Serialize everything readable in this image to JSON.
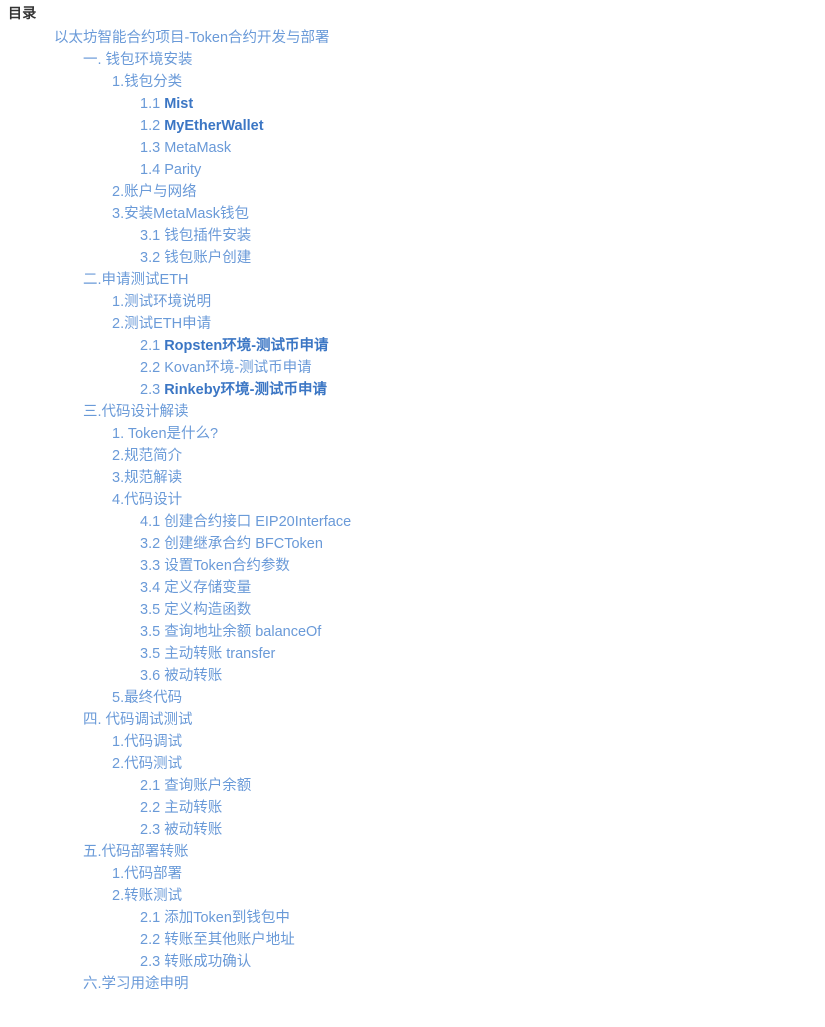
{
  "heading": "目录",
  "colors": {
    "link": "#6a9ad8",
    "link_bold": "#3b76c4",
    "heading": "#333333",
    "background": "#ffffff"
  },
  "toc": {
    "items": [
      {
        "level": 1,
        "num": "",
        "label": "以太坊智能合约项目-Token合约开发与部署",
        "bold": false
      },
      {
        "level": 2,
        "num": "",
        "label": "一. 钱包环境安装",
        "bold": false
      },
      {
        "level": 3,
        "num": "",
        "label": "1.钱包分类",
        "bold": false
      },
      {
        "level": 4,
        "num": "1.1",
        "label": "Mist",
        "bold": true
      },
      {
        "level": 4,
        "num": "1.2",
        "label": "MyEtherWallet",
        "bold": true
      },
      {
        "level": 4,
        "num": "1.3",
        "label": "MetaMask",
        "bold": false
      },
      {
        "level": 4,
        "num": "1.4",
        "label": "Parity",
        "bold": false
      },
      {
        "level": 3,
        "num": "",
        "label": "2.账户与网络",
        "bold": false
      },
      {
        "level": 3,
        "num": "",
        "label": "3.安装MetaMask钱包",
        "bold": false
      },
      {
        "level": 4,
        "num": "3.1",
        "label": "钱包插件安装",
        "bold": false
      },
      {
        "level": 4,
        "num": "3.2",
        "label": "钱包账户创建",
        "bold": false
      },
      {
        "level": 2,
        "num": "",
        "label": "二.申请测试ETH",
        "bold": false
      },
      {
        "level": 3,
        "num": "",
        "label": "1.测试环境说明",
        "bold": false
      },
      {
        "level": 3,
        "num": "",
        "label": "2.测试ETH申请",
        "bold": false
      },
      {
        "level": 4,
        "num": "2.1",
        "label": "Ropsten环境-测试币申请",
        "bold": true
      },
      {
        "level": 4,
        "num": "2.2",
        "label": "Kovan环境-测试币申请",
        "bold": false
      },
      {
        "level": 4,
        "num": "2.3",
        "label": "Rinkeby环境-测试币申请",
        "bold": true
      },
      {
        "level": 2,
        "num": "",
        "label": "三.代码设计解读",
        "bold": false
      },
      {
        "level": 3,
        "num": "",
        "label": "1. Token是什么?",
        "bold": false
      },
      {
        "level": 3,
        "num": "",
        "label": "2.规范简介",
        "bold": false
      },
      {
        "level": 3,
        "num": "",
        "label": "3.规范解读",
        "bold": false
      },
      {
        "level": 3,
        "num": "",
        "label": "4.代码设计",
        "bold": false
      },
      {
        "level": 4,
        "num": "4.1",
        "label": "创建合约接口 EIP20Interface",
        "bold": false
      },
      {
        "level": 4,
        "num": "3.2",
        "label": "创建继承合约 BFCToken",
        "bold": false
      },
      {
        "level": 4,
        "num": "3.3",
        "label": "设置Token合约参数",
        "bold": false
      },
      {
        "level": 4,
        "num": "3.4",
        "label": "定义存储变量",
        "bold": false
      },
      {
        "level": 4,
        "num": "3.5",
        "label": "定义构造函数",
        "bold": false
      },
      {
        "level": 4,
        "num": "3.5",
        "label": "查询地址余额 balanceOf",
        "bold": false
      },
      {
        "level": 4,
        "num": "3.5",
        "label": "主动转账 transfer",
        "bold": false
      },
      {
        "level": 4,
        "num": "3.6",
        "label": "被动转账",
        "bold": false
      },
      {
        "level": 3,
        "num": "",
        "label": "5.最终代码",
        "bold": false
      },
      {
        "level": 2,
        "num": "",
        "label": "四. 代码调试测试",
        "bold": false
      },
      {
        "level": 3,
        "num": "",
        "label": "1.代码调试",
        "bold": false
      },
      {
        "level": 3,
        "num": "",
        "label": "2.代码测试",
        "bold": false
      },
      {
        "level": 4,
        "num": "2.1",
        "label": "查询账户余额",
        "bold": false
      },
      {
        "level": 4,
        "num": "2.2",
        "label": "主动转账",
        "bold": false
      },
      {
        "level": 4,
        "num": "2.3",
        "label": "被动转账",
        "bold": false
      },
      {
        "level": 2,
        "num": "",
        "label": "五.代码部署转账",
        "bold": false
      },
      {
        "level": 3,
        "num": "",
        "label": "1.代码部署",
        "bold": false
      },
      {
        "level": 3,
        "num": "",
        "label": "2.转账测试",
        "bold": false
      },
      {
        "level": 4,
        "num": "2.1",
        "label": "添加Token到钱包中",
        "bold": false
      },
      {
        "level": 4,
        "num": "2.2",
        "label": "转账至其他账户地址",
        "bold": false
      },
      {
        "level": 4,
        "num": "2.3",
        "label": "转账成功确认",
        "bold": false
      },
      {
        "level": 2,
        "num": "",
        "label": "六.学习用途申明",
        "bold": false
      }
    ]
  }
}
